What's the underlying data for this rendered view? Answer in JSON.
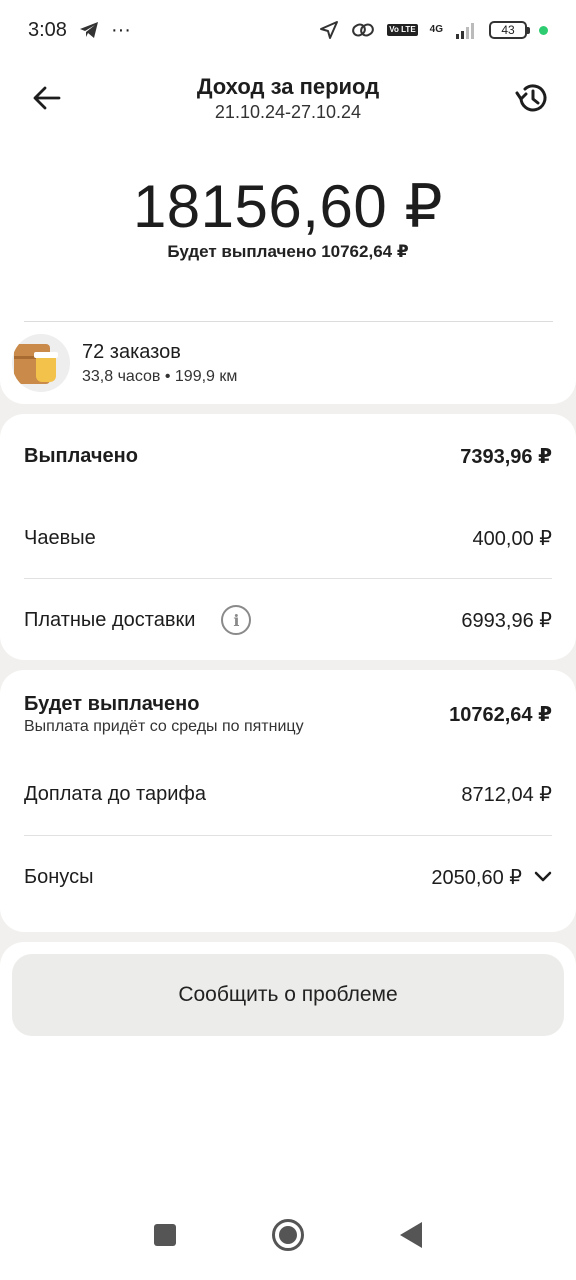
{
  "status_bar": {
    "time": "3:08",
    "dots": "···",
    "volte": "Vo LTE",
    "network": "4G",
    "battery": "43"
  },
  "header": {
    "title": "Доход за период",
    "subtitle": "21.10.24-27.10.24"
  },
  "total": {
    "amount": "18156,60 ₽",
    "note": "Будет выплачено 10762,64 ₽"
  },
  "orders": {
    "count": "72 заказов",
    "meta": "33,8 часов • 199,9 км"
  },
  "paid": {
    "title": "Выплачено",
    "total": "7393,96 ₽",
    "tips_label": "Чаевые",
    "tips_value": "400,00 ₽",
    "paid_deliveries_label": "Платные доставки",
    "paid_deliveries_value": "6993,96 ₽"
  },
  "future": {
    "title": "Будет выплачено",
    "subtitle": "Выплата придёт со среды по пятницу",
    "total": "10762,64 ₽",
    "surcharge_label": "Доплата до тарифа",
    "surcharge_value": "8712,04 ₽",
    "bonus_label": "Бонусы",
    "bonus_value": "2050,60 ₽"
  },
  "report": {
    "button_label": "Сообщить о проблеме"
  }
}
